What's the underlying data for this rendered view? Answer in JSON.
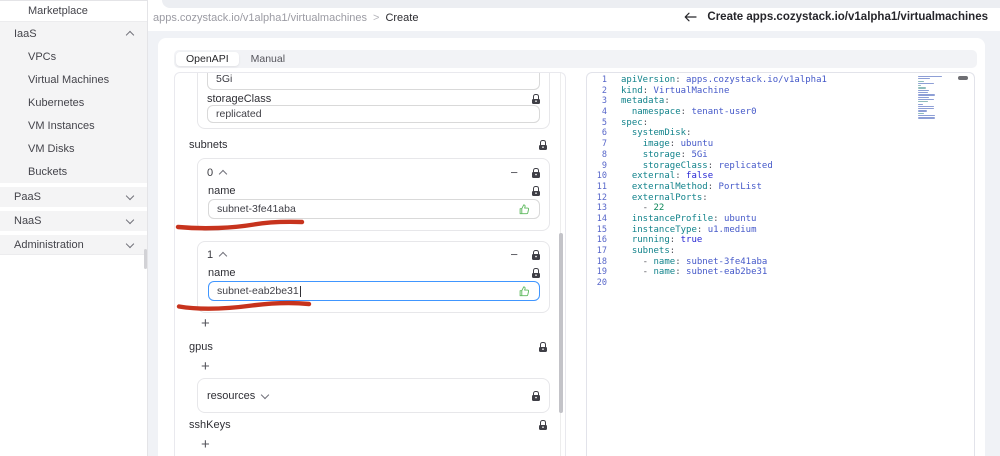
{
  "sidebar": {
    "items": [
      {
        "label": "Marketplace",
        "variant": "standalone"
      },
      {
        "label": "IaaS",
        "variant": "group-expanded",
        "chevron": "up"
      },
      {
        "label": "VPCs",
        "variant": "group-child"
      },
      {
        "label": "Virtual Machines",
        "variant": "group-child"
      },
      {
        "label": "Kubernetes",
        "variant": "group-child"
      },
      {
        "label": "VM Instances",
        "variant": "group-child"
      },
      {
        "label": "VM Disks",
        "variant": "group-child"
      },
      {
        "label": "Buckets",
        "variant": "group-child"
      },
      {
        "label": "PaaS",
        "variant": "group-collapsed",
        "chevron": "down"
      },
      {
        "label": "NaaS",
        "variant": "group-collapsed",
        "chevron": "down"
      },
      {
        "label": "Administration",
        "variant": "group-collapsed",
        "chevron": "down",
        "last": true
      }
    ]
  },
  "header": {
    "breadcrumb": {
      "path": "apps.cozystack.io/v1alpha1/virtualmachines",
      "separator": ">",
      "current": "Create"
    },
    "title": "Create apps.cozystack.io/v1alpha1/virtualmachines"
  },
  "tabs": {
    "openapi": "OpenAPI",
    "manual": "Manual"
  },
  "form": {
    "partial_field": {
      "value": "5Gi"
    },
    "storage_class": {
      "label": "storageClass",
      "value": "replicated"
    },
    "subnets": {
      "label": "subnets",
      "items": [
        {
          "index": "0",
          "name_label": "name",
          "name_value": "subnet-3fe41aba",
          "focused": false
        },
        {
          "index": "1",
          "name_label": "name",
          "name_value": "subnet-eab2be31",
          "focused": true
        }
      ],
      "add_label": "+"
    },
    "gpus": {
      "label": "gpus",
      "add_label": "+"
    },
    "resources": {
      "label": "resources"
    },
    "ssh_keys": {
      "label": "sshKeys",
      "add_label": "+"
    }
  },
  "editor": {
    "lines": [
      {
        "num": "1",
        "segs": [
          [
            "k",
            "apiVersion"
          ],
          [
            "p",
            ": "
          ],
          [
            "s",
            "apps.cozystack.io/v1alpha1"
          ]
        ]
      },
      {
        "num": "2",
        "segs": [
          [
            "k",
            "kind"
          ],
          [
            "p",
            ": "
          ],
          [
            "s",
            "VirtualMachine"
          ]
        ]
      },
      {
        "num": "3",
        "segs": [
          [
            "k",
            "metadata"
          ],
          [
            "p",
            ":"
          ]
        ]
      },
      {
        "num": "4",
        "segs": [
          [
            "p",
            "  "
          ],
          [
            "k",
            "namespace"
          ],
          [
            "p",
            ": "
          ],
          [
            "s",
            "tenant-user0"
          ]
        ]
      },
      {
        "num": "5",
        "segs": [
          [
            "k",
            "spec"
          ],
          [
            "p",
            ":"
          ]
        ]
      },
      {
        "num": "6",
        "segs": [
          [
            "p",
            "  "
          ],
          [
            "k",
            "systemDisk"
          ],
          [
            "p",
            ":"
          ]
        ]
      },
      {
        "num": "7",
        "segs": [
          [
            "p",
            "    "
          ],
          [
            "k",
            "image"
          ],
          [
            "p",
            ": "
          ],
          [
            "s",
            "ubuntu"
          ]
        ]
      },
      {
        "num": "8",
        "segs": [
          [
            "p",
            "    "
          ],
          [
            "k",
            "storage"
          ],
          [
            "p",
            ": "
          ],
          [
            "s",
            "5Gi"
          ]
        ]
      },
      {
        "num": "9",
        "segs": [
          [
            "p",
            "    "
          ],
          [
            "k",
            "storageClass"
          ],
          [
            "p",
            ": "
          ],
          [
            "s",
            "replicated"
          ]
        ]
      },
      {
        "num": "10",
        "segs": [
          [
            "p",
            "  "
          ],
          [
            "k",
            "external"
          ],
          [
            "p",
            ": "
          ],
          [
            "b",
            "false"
          ]
        ]
      },
      {
        "num": "11",
        "segs": [
          [
            "p",
            "  "
          ],
          [
            "k",
            "externalMethod"
          ],
          [
            "p",
            ": "
          ],
          [
            "s",
            "PortList"
          ]
        ]
      },
      {
        "num": "12",
        "segs": [
          [
            "p",
            "  "
          ],
          [
            "k",
            "externalPorts"
          ],
          [
            "p",
            ":"
          ]
        ]
      },
      {
        "num": "13",
        "segs": [
          [
            "p",
            "    - "
          ],
          [
            "n",
            "22"
          ]
        ]
      },
      {
        "num": "14",
        "segs": [
          [
            "p",
            "  "
          ],
          [
            "k",
            "instanceProfile"
          ],
          [
            "p",
            ": "
          ],
          [
            "s",
            "ubuntu"
          ]
        ]
      },
      {
        "num": "15",
        "segs": [
          [
            "p",
            "  "
          ],
          [
            "k",
            "instanceType"
          ],
          [
            "p",
            ": "
          ],
          [
            "s",
            "u1.medium"
          ]
        ]
      },
      {
        "num": "16",
        "segs": [
          [
            "p",
            "  "
          ],
          [
            "k",
            "running"
          ],
          [
            "p",
            ": "
          ],
          [
            "b",
            "true"
          ]
        ]
      },
      {
        "num": "17",
        "segs": [
          [
            "p",
            "  "
          ],
          [
            "k",
            "subnets"
          ],
          [
            "p",
            ":"
          ]
        ]
      },
      {
        "num": "18",
        "segs": [
          [
            "p",
            "    - "
          ],
          [
            "k",
            "name"
          ],
          [
            "p",
            ": "
          ],
          [
            "s",
            "subnet-3fe41aba"
          ]
        ]
      },
      {
        "num": "19",
        "segs": [
          [
            "p",
            "    - "
          ],
          [
            "k",
            "name"
          ],
          [
            "p",
            ": "
          ],
          [
            "s",
            "subnet-eab2be31"
          ]
        ]
      },
      {
        "num": "20",
        "segs": []
      }
    ]
  },
  "annotations": {
    "color": "#c7331d",
    "strokes": [
      {
        "target": "subnet-0-name-underline"
      },
      {
        "target": "subnet-1-name-underline"
      }
    ]
  },
  "colors": {
    "focus_blue": "#4096ff",
    "like_green": "#5eb95e",
    "annotation_red": "#c7331d"
  }
}
